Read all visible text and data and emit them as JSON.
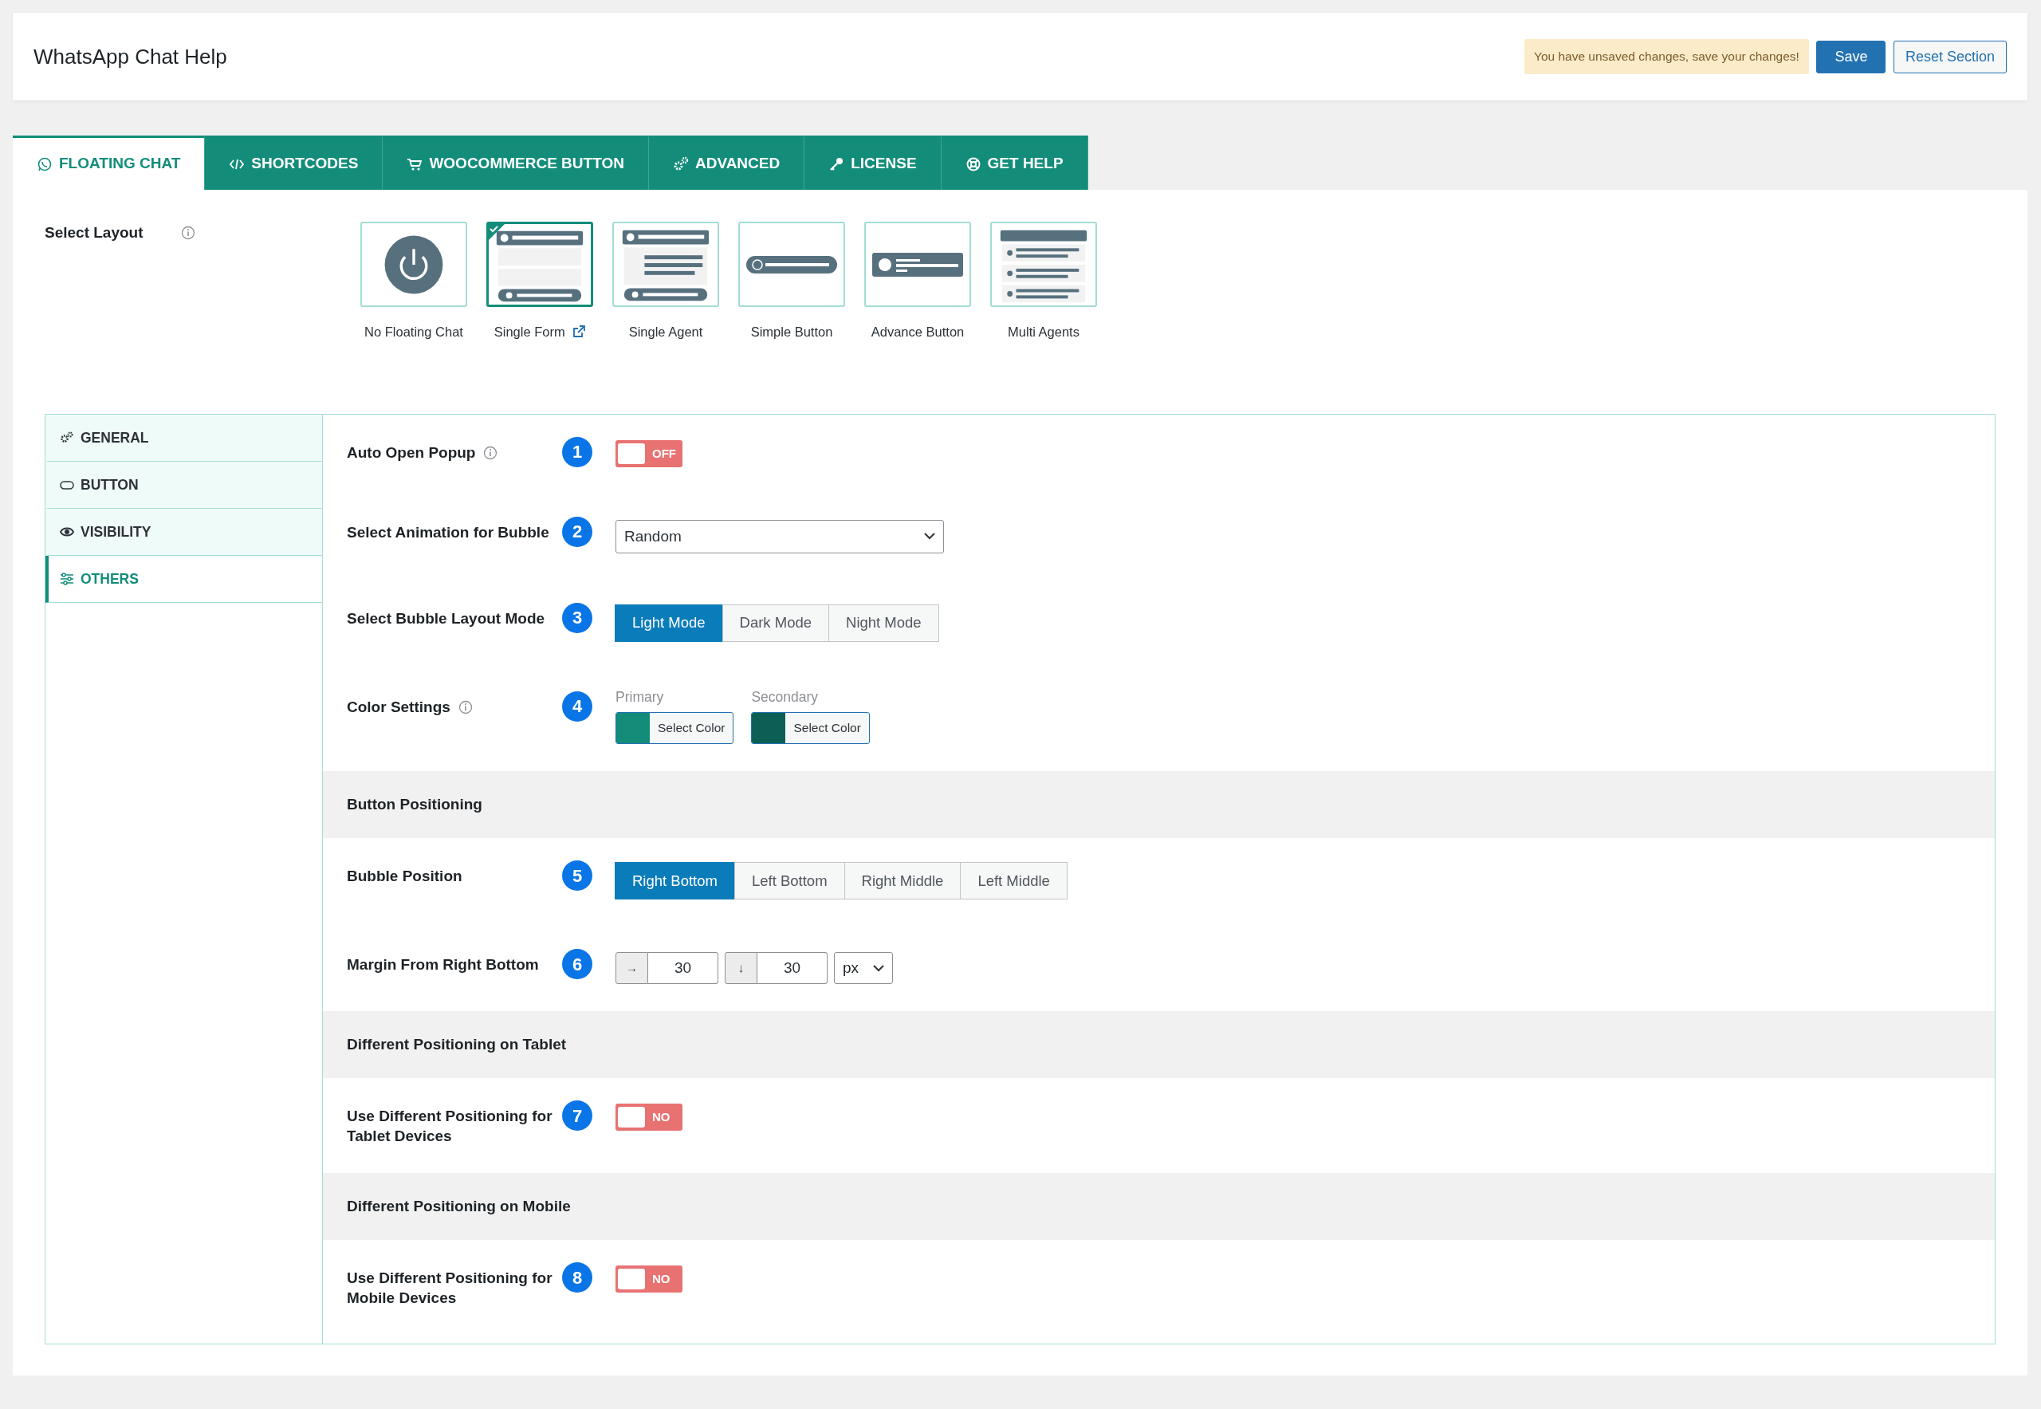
{
  "header": {
    "title": "WhatsApp Chat Help",
    "notice": "You have unsaved changes, save your changes!",
    "buttons": [
      {
        "label": "Save",
        "kind": "primary"
      },
      {
        "label": "Reset Section",
        "kind": "outline"
      }
    ]
  },
  "tabs": [
    {
      "label": "FLOATING CHAT",
      "selected": true
    },
    {
      "label": "SHORTCODES",
      "selected": false
    },
    {
      "label": "WOOCOMMERCE BUTTON",
      "selected": false
    },
    {
      "label": "ADVANCED",
      "selected": false
    },
    {
      "label": "LICENSE",
      "selected": false
    },
    {
      "label": "GET HELP",
      "selected": false
    }
  ],
  "layout": {
    "label": "Select Layout",
    "options": [
      {
        "label": "No Floating Chat",
        "kind": "none",
        "selected": false,
        "external_link": false
      },
      {
        "label": "Single Form",
        "kind": "form",
        "selected": true,
        "external_link": true
      },
      {
        "label": "Single Agent",
        "kind": "agent",
        "selected": false,
        "external_link": false
      },
      {
        "label": "Simple Button",
        "kind": "button",
        "selected": false,
        "external_link": false
      },
      {
        "label": "Advance Button",
        "kind": "advance",
        "selected": false,
        "external_link": false
      },
      {
        "label": "Multi Agents",
        "kind": "multi",
        "selected": false,
        "external_link": false
      }
    ]
  },
  "sidebar": {
    "items": [
      {
        "label": "GENERAL",
        "selected": false
      },
      {
        "label": "BUTTON",
        "selected": false
      },
      {
        "label": "VISIBILITY",
        "selected": false
      },
      {
        "label": "OTHERS",
        "selected": true
      }
    ]
  },
  "settings": [
    {
      "kind": "toggle",
      "label": "Auto Open Popup",
      "info": true,
      "number": "1",
      "on": false,
      "toggle_text": "OFF"
    },
    {
      "kind": "select",
      "label": "Select Animation for Bubble",
      "number": "2",
      "value": "Random"
    },
    {
      "kind": "segmented",
      "label": "Select Bubble Layout Mode",
      "number": "3",
      "options": [
        {
          "label": "Light Mode",
          "selected": true
        },
        {
          "label": "Dark Mode",
          "selected": false
        },
        {
          "label": "Night Mode",
          "selected": false
        }
      ]
    },
    {
      "kind": "colors",
      "label": "Color Settings",
      "info": true,
      "number": "4",
      "colors": [
        {
          "label": "Primary",
          "color": "#138d7a",
          "button": "Select Color"
        },
        {
          "label": "Secondary",
          "color": "#0b5f55",
          "button": "Select Color"
        }
      ]
    },
    {
      "kind": "section",
      "label": "Button Positioning"
    },
    {
      "kind": "segmented",
      "label": "Bubble Position",
      "number": "5",
      "options": [
        {
          "label": "Right Bottom",
          "selected": true
        },
        {
          "label": "Left Bottom",
          "selected": false
        },
        {
          "label": "Right Middle",
          "selected": false
        },
        {
          "label": "Left Middle",
          "selected": false
        }
      ]
    },
    {
      "kind": "margin",
      "label": "Margin From Right Bottom",
      "number": "6",
      "inputs": [
        {
          "prefix": "→",
          "value": "30"
        },
        {
          "prefix": "↓",
          "value": "30"
        }
      ],
      "unit": "px"
    },
    {
      "kind": "section",
      "label": "Different Positioning on Tablet"
    },
    {
      "kind": "toggle",
      "label": "Use Different Positioning for Tablet Devices",
      "number": "7",
      "on": false,
      "toggle_text": "NO"
    },
    {
      "kind": "section",
      "label": "Different Positioning on Mobile"
    },
    {
      "kind": "toggle",
      "label": "Use Different Positioning for Mobile Devices",
      "number": "8",
      "on": false,
      "toggle_text": "NO"
    }
  ]
}
